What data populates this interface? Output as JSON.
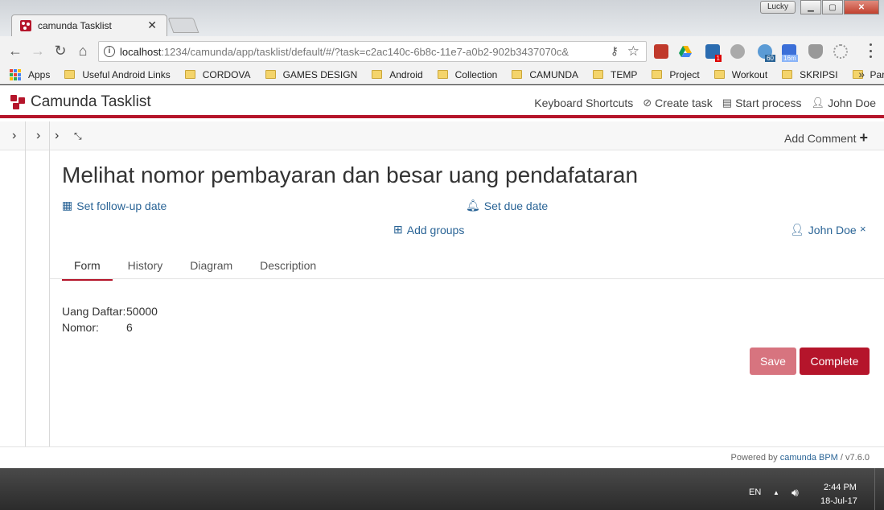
{
  "browser": {
    "tab_title": "camunda Tasklist",
    "user_badge": "Lucky",
    "url_host": "localhost",
    "url_rest": ":1234/camunda/app/tasklist/default/#/?task=c2ac140c-6b8c-11e7-a0b2-902b3437070c&",
    "bookmarks": [
      {
        "label": "Apps",
        "type": "apps"
      },
      {
        "label": "Useful Android Links",
        "type": "folder"
      },
      {
        "label": "CORDOVA",
        "type": "folder"
      },
      {
        "label": "GAMES DESIGN",
        "type": "folder"
      },
      {
        "label": "Android",
        "type": "folder"
      },
      {
        "label": "Collection",
        "type": "folder"
      },
      {
        "label": "CAMUNDA",
        "type": "folder"
      },
      {
        "label": "TEMP",
        "type": "folder"
      },
      {
        "label": "Project",
        "type": "folder"
      },
      {
        "label": "Workout",
        "type": "folder"
      },
      {
        "label": "SKRIPSI",
        "type": "folder"
      },
      {
        "label": "Par",
        "type": "folder"
      }
    ],
    "bookmarks_more": "»",
    "ext_badges": {
      "office": "1",
      "timer": "60",
      "calendar": "16m"
    }
  },
  "header": {
    "brand": "Camunda Tasklist",
    "links": {
      "shortcuts": "Keyboard Shortcuts",
      "create_task": "Create task",
      "start_process": "Start process",
      "user": "John Doe"
    }
  },
  "subbar": {
    "add_comment": "Add Comment",
    "plus": "+"
  },
  "task": {
    "title": "Melihat nomor pembayaran dan besar uang pendafataran",
    "follow_up": "Set follow-up date",
    "due_date": "Set due date",
    "add_groups": "Add groups",
    "assignee": "John Doe",
    "assignee_remove": "×"
  },
  "tabs": [
    "Form",
    "History",
    "Diagram",
    "Description"
  ],
  "form": {
    "fields": [
      {
        "label": "Uang Daftar:",
        "value": "50000"
      },
      {
        "label": "Nomor:",
        "value": "6"
      }
    ],
    "save_label": "Save",
    "complete_label": "Complete"
  },
  "footer": {
    "powered": "Powered by",
    "product": "camunda BPM",
    "version": "/ v7.6.0"
  },
  "taskbar": {
    "lang": "EN",
    "time": "2:44 PM",
    "date": "18-Jul-17"
  },
  "colors": {
    "brand": "#b5152b",
    "link": "#2a6496",
    "save_disabled": "#d7747f"
  }
}
